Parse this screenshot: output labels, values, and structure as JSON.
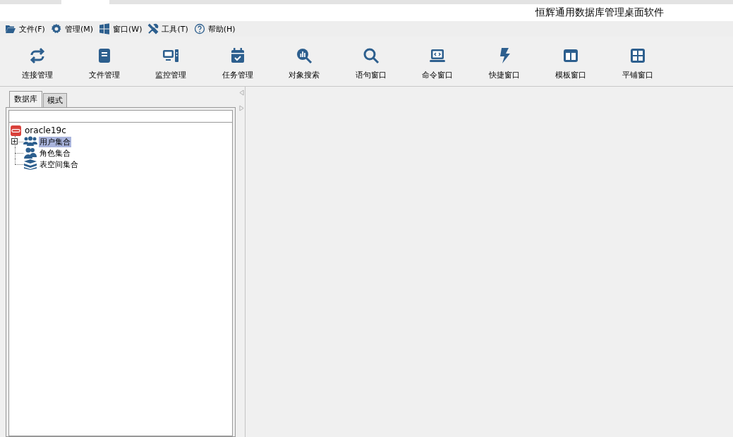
{
  "window": {
    "title": "恒辉通用数据库管理桌面软件"
  },
  "menu": [
    {
      "label": "文件(F)"
    },
    {
      "label": "管理(M)"
    },
    {
      "label": "窗口(W)"
    },
    {
      "label": "工具(T)"
    },
    {
      "label": "帮助(H)"
    }
  ],
  "toolbar": [
    {
      "label": "连接管理"
    },
    {
      "label": "文件管理"
    },
    {
      "label": "监控管理"
    },
    {
      "label": "任务管理"
    },
    {
      "label": "对象搜索"
    },
    {
      "label": "语句窗口"
    },
    {
      "label": "命令窗口"
    },
    {
      "label": "快捷窗口"
    },
    {
      "label": "模板窗口"
    },
    {
      "label": "平铺窗口"
    }
  ],
  "tabs": [
    {
      "label": "数据库",
      "selected": true
    },
    {
      "label": "模式",
      "selected": false
    }
  ],
  "tree": [
    {
      "label": "oracle19c",
      "selected": false,
      "children": [
        {
          "label": "用户集合",
          "selected": true,
          "expandable": true
        },
        {
          "label": "角色集合",
          "selected": false,
          "expandable": false
        },
        {
          "label": "表空间集合",
          "selected": false,
          "expandable": false
        }
      ]
    }
  ]
}
